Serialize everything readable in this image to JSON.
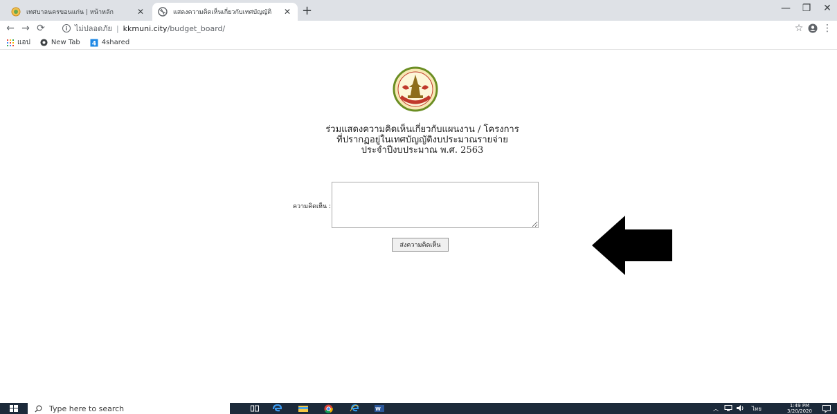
{
  "browser": {
    "tabs": [
      {
        "title": "เทศบาลนครขอนแก่น | หน้าหลัก"
      },
      {
        "title": "แสดงความคิดเห็นเกี่ยวกับเทศบัญญัติ"
      }
    ],
    "new_tab_symbol": "+",
    "window_controls": {
      "minimize": "—",
      "restore": "❐",
      "close": "✕"
    },
    "omnibox": {
      "security_text": "ไม่ปลอดภัย",
      "separator": "|",
      "host": "kkmuni.city",
      "path": "/budget_board/"
    },
    "bookmarks": [
      {
        "label": "แอป",
        "icon": "apps-grid-icon"
      },
      {
        "label": "New Tab",
        "icon": "chrome-icon"
      },
      {
        "label": "4shared",
        "icon": "4shared-icon"
      }
    ]
  },
  "page": {
    "heading_lines": [
      "ร่วมแสดงความคิดเห็นเกี่ยวกับแผนงาน / โครงการ",
      "ที่ปรากฏอยู่ในเทศบัญญัติงบประมาณรายจ่าย",
      "ประจำปีงบประมาณ พ.ศ. 2563"
    ],
    "comment_label": "ความคิดเห็น :",
    "comment_value": "",
    "submit_label": "ส่งความคิดเห็น"
  },
  "taskbar": {
    "search_placeholder": "Type here to search",
    "language": "ไทย",
    "time": "1:49 PM",
    "date": "3/20/2020"
  },
  "colors": {
    "tabstrip": "#dee1e6",
    "taskbar": "#1c2a3a",
    "arrow": "#000000"
  }
}
